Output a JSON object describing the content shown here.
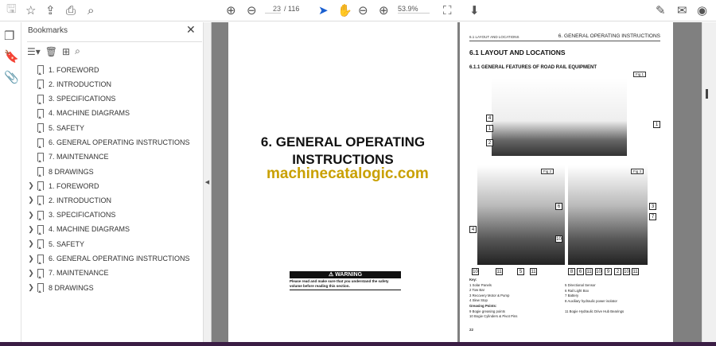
{
  "toolbar": {
    "page_current": "23",
    "page_total": "/ 116",
    "zoom": "53.9%",
    "icons": [
      "save-icon",
      "star-icon",
      "upload-icon",
      "print-icon",
      "search-icon",
      "page-up-icon",
      "page-down-icon",
      "select-cursor-icon",
      "hand-icon",
      "zoom-out-icon",
      "zoom-in-icon",
      "fit-page-icon",
      "read-mode-icon",
      "sign-icon",
      "mail-icon",
      "account-icon"
    ]
  },
  "bookmarks": {
    "title": "Bookmarks",
    "close": "✕",
    "items_flat": [
      "1. FOREWORD",
      "2. INTRODUCTION",
      "3. SPECIFICATIONS",
      "4. MACHINE DIAGRAMS",
      "5. SAFETY",
      "6. GENERAL OPERATING INSTRUCTIONS",
      "7. MAINTENANCE",
      "8 DRAWINGS"
    ],
    "items_tree": [
      "1. FOREWORD",
      "2. INTRODUCTION",
      "3. SPECIFICATIONS",
      "4. MACHINE DIAGRAMS",
      "5. SAFETY",
      "6. GENERAL OPERATING INSTRUCTIONS",
      "7. MAINTENANCE",
      "8 DRAWINGS"
    ]
  },
  "page1": {
    "title_line1": "6. GENERAL OPERATING",
    "title_line2": "INSTRUCTIONS",
    "watermark": "machinecatalogic.com",
    "warning_title": "⚠ WARNING",
    "warning_text": "Please read and make sure that you understand the safety volume before reading this section."
  },
  "page2": {
    "header_left": "6.1 LAYOUT AND LOCATIONS",
    "header_right": "6. GENERAL OPERATING INSTRUCTIONS",
    "heading": "6.1 LAYOUT AND LOCATIONS",
    "subheading": "6.1.1 GENERAL FEATURES OF ROAD RAIL EQUIPMENT",
    "fig1": "Fig 1",
    "fig2": "Fig 2",
    "fig3": "Fig 3",
    "fig1_labels": [
      "4",
      "1",
      "2",
      "1"
    ],
    "fig2_labels": [
      "6",
      "4",
      "10"
    ],
    "fig3_labels": [
      "3",
      "7"
    ],
    "fig2_bottom": [
      "10",
      "11",
      "5",
      "11"
    ],
    "fig3_bottom": [
      "8",
      "6",
      "11",
      "10",
      "9",
      "2",
      "10",
      "11"
    ],
    "key_title": "Key:",
    "key_left": [
      "1   Solar Panels",
      "2   Tow Bar",
      "3   Recovery Motor & Pump",
      "4   Slew Stop"
    ],
    "greasing_title": "Greasing Points:",
    "greasing_left": [
      "9    Bogie greasing points",
      "10  Bogie Cylinders & Pivot Pins"
    ],
    "key_right": [
      "5   Directional Sensor",
      "6   Rail Light Box",
      "7   Battery",
      "8   Auxiliary hydraulic power isolator"
    ],
    "greasing_right": "11  Bogie Hydraulic Drive Hub Bearings",
    "page_number": "22"
  }
}
